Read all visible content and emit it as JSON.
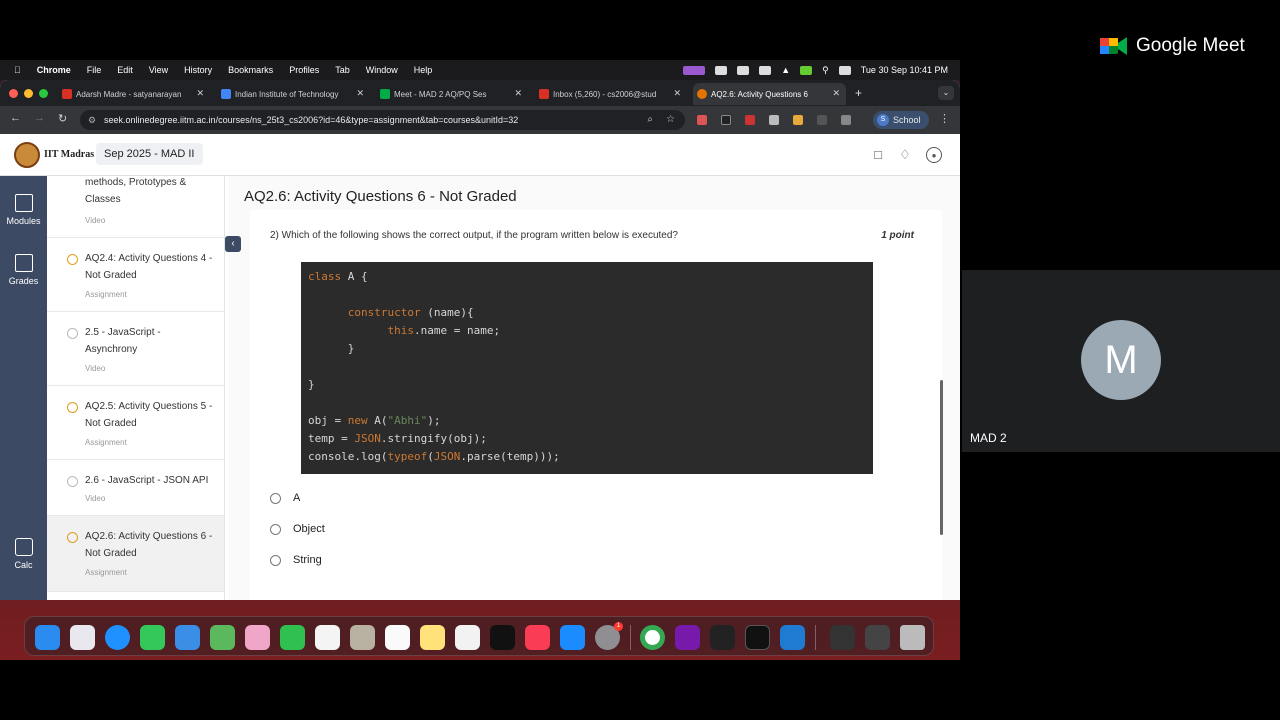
{
  "meet": {
    "brand": "Google Meet",
    "participant_initial": "M",
    "participant_name": "MAD 2"
  },
  "menubar": {
    "app": "Chrome",
    "items": [
      "File",
      "Edit",
      "View",
      "History",
      "Bookmarks",
      "Profiles",
      "Tab",
      "Window",
      "Help"
    ],
    "datetime": "Tue 30 Sep  10:41 PM"
  },
  "browser": {
    "tabs": [
      {
        "label": "Adarsh Madre - satyanarayan",
        "color": "#d93025"
      },
      {
        "label": "Indian Institute of Technology",
        "color": "#4285f4"
      },
      {
        "label": "Meet - MAD 2 AQ/PQ Ses",
        "color": "#00ac47"
      },
      {
        "label": "Inbox (5,260) - cs2006@stud",
        "color": "#d93025"
      },
      {
        "label": "AQ2.6: Activity Questions 6",
        "color": "#e37400"
      }
    ],
    "url": "seek.onlinedegree.iitm.ac.in/courses/ns_25t3_cs2006?id=46&type=assignment&tab=courses&unitId=32",
    "profile": "School",
    "profile_initial": "S"
  },
  "app": {
    "institute": "IIT Madras",
    "course": "Sep 2025 - MAD II"
  },
  "rail": [
    {
      "label": "Modules"
    },
    {
      "label": "Grades"
    },
    {
      "label": "Calc"
    }
  ],
  "modules": [
    {
      "title": "methods, Prototypes & Classes",
      "type": "Video"
    },
    {
      "title": "AQ2.4: Activity Questions 4 - Not Graded",
      "type": "Assignment"
    },
    {
      "title": "2.5 - JavaScript - Asynchrony",
      "type": "Video"
    },
    {
      "title": "AQ2.5: Activity Questions 5 - Not Graded",
      "type": "Assignment"
    },
    {
      "title": "2.6 - JavaScript - JSON API",
      "type": "Video"
    },
    {
      "title": "AQ2.6: Activity Questions 6 - Not Graded",
      "type": "Assignment"
    }
  ],
  "assignment": {
    "title": "AQ2.6: Activity Questions 6 - Not Graded",
    "question": "2) Which of the following shows the correct output, if the program written below is executed?",
    "points": "1 point",
    "code": {
      "l1a": "class",
      "l1b": " A {",
      "l3a": "      constructor",
      "l3b": " (name){",
      "l4a": "            this",
      "l4b": ".name = name;",
      "l5": "      }",
      "l7": "}",
      "l9a": "obj = ",
      "l9b": "new",
      "l9c": " A(",
      "l9d": "\"Abhi\"",
      "l9e": ");",
      "l10a": "temp = ",
      "l10b": "JSON",
      "l10c": ".stringify(obj);",
      "l11a": "console.log(",
      "l11b": "typeof",
      "l11c": "(",
      "l11d": "JSON",
      "l11e": ".parse(temp)));"
    },
    "options": [
      "A",
      "Object",
      "String"
    ]
  },
  "dock_badge": "1"
}
